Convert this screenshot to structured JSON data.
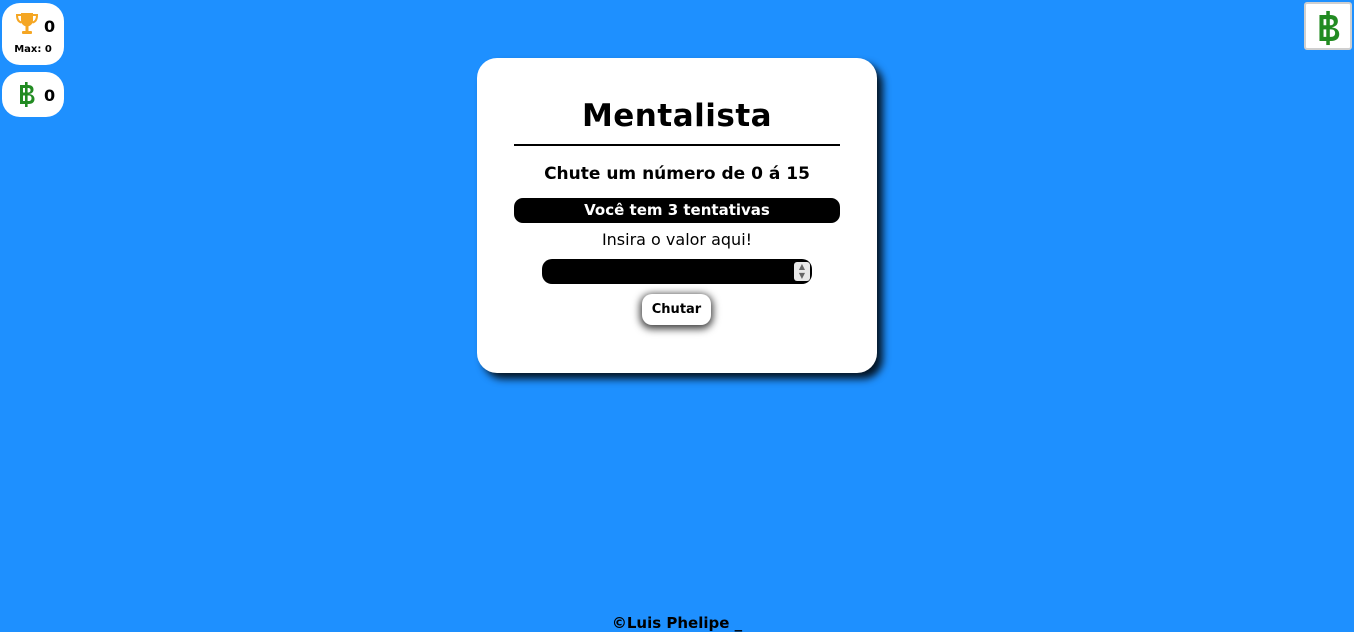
{
  "scoreboard": {
    "score": "0",
    "max_label": "Max: 0",
    "trophy_icon": "trophy-icon",
    "trophy_color": "#f5a623"
  },
  "wallet": {
    "coins": "0",
    "coin_icon": "baht-sign-icon",
    "coin_color": "#228b22"
  },
  "shop": {
    "icon": "baht-sign-icon"
  },
  "game": {
    "title": "Mentalista",
    "instruction": "Chute um número de 0 á 15",
    "attempts": "Você tem 3 tentativas",
    "input_label": "Insira o valor aqui!",
    "input_value": "",
    "submit_label": "Chutar"
  },
  "footer": {
    "credit": "©Luis Phelipe _"
  },
  "colors": {
    "background": "#1e90ff",
    "card": "#ffffff",
    "accent_dark": "#000000"
  }
}
